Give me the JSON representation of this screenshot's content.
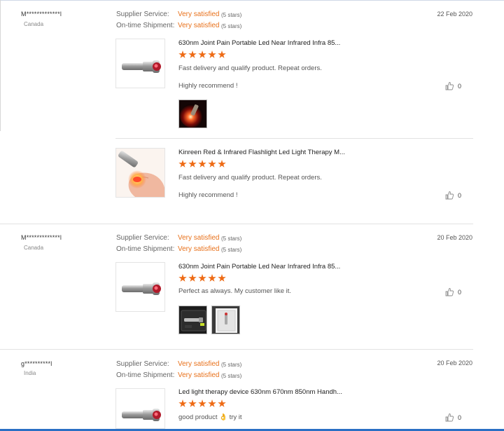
{
  "reviews": [
    {
      "buyer": "M*************l",
      "country": "Canada",
      "date": "22 Feb 2020",
      "supplier_label": "Supplier Service:",
      "supplier_value": "Very satisfied",
      "supplier_stars": "(5 stars)",
      "shipment_label": "On-time Shipment:",
      "shipment_value": "Very satisfied",
      "shipment_stars": "(5 stars)",
      "products": [
        {
          "title": "630nm Joint Pain Portable Led Near Infrared Infra 85...",
          "rating": 5,
          "text1": "Fast delivery and qualify product. Repeat orders.",
          "text2": "Highly recommend !",
          "likes": "0",
          "photos": [
            "red-light-photo"
          ]
        },
        {
          "title": "Kinreen Red & Infrared Flashlight Led Light Therapy M...",
          "rating": 5,
          "text1": "Fast delivery and qualify product. Repeat orders.",
          "text2": "Highly recommend !",
          "likes": "0",
          "photos": []
        }
      ]
    },
    {
      "buyer": "M*************l",
      "country": "Canada",
      "date": "20 Feb 2020",
      "supplier_label": "Supplier Service:",
      "supplier_value": "Very satisfied",
      "supplier_stars": "(5 stars)",
      "shipment_label": "On-time Shipment:",
      "shipment_value": "Very satisfied",
      "shipment_stars": "(5 stars)",
      "products": [
        {
          "title": "630nm Joint Pain Portable Led Near Infrared Infra 85...",
          "rating": 5,
          "text1": "Perfect as always. My customer like it.",
          "likes": "0",
          "photos": [
            "case-photo",
            "box-photo"
          ]
        }
      ]
    },
    {
      "buyer": "g**********l",
      "country": "India",
      "date": "20 Feb 2020",
      "supplier_label": "Supplier Service:",
      "supplier_value": "Very satisfied",
      "supplier_stars": "(5 stars)",
      "shipment_label": "On-time Shipment:",
      "shipment_value": "Very satisfied",
      "shipment_stars": "(5 stars)",
      "products": [
        {
          "title": "Led light therapy device 630nm 670nm 850nm Handh...",
          "rating": 5,
          "text1": "good product 👌 try it",
          "likes": "0",
          "photos": []
        }
      ]
    }
  ],
  "colors": {
    "accent": "#e8711b",
    "star": "#ee6a14",
    "label": "#666666"
  },
  "icons": {
    "like": "thumbs-up-icon"
  }
}
